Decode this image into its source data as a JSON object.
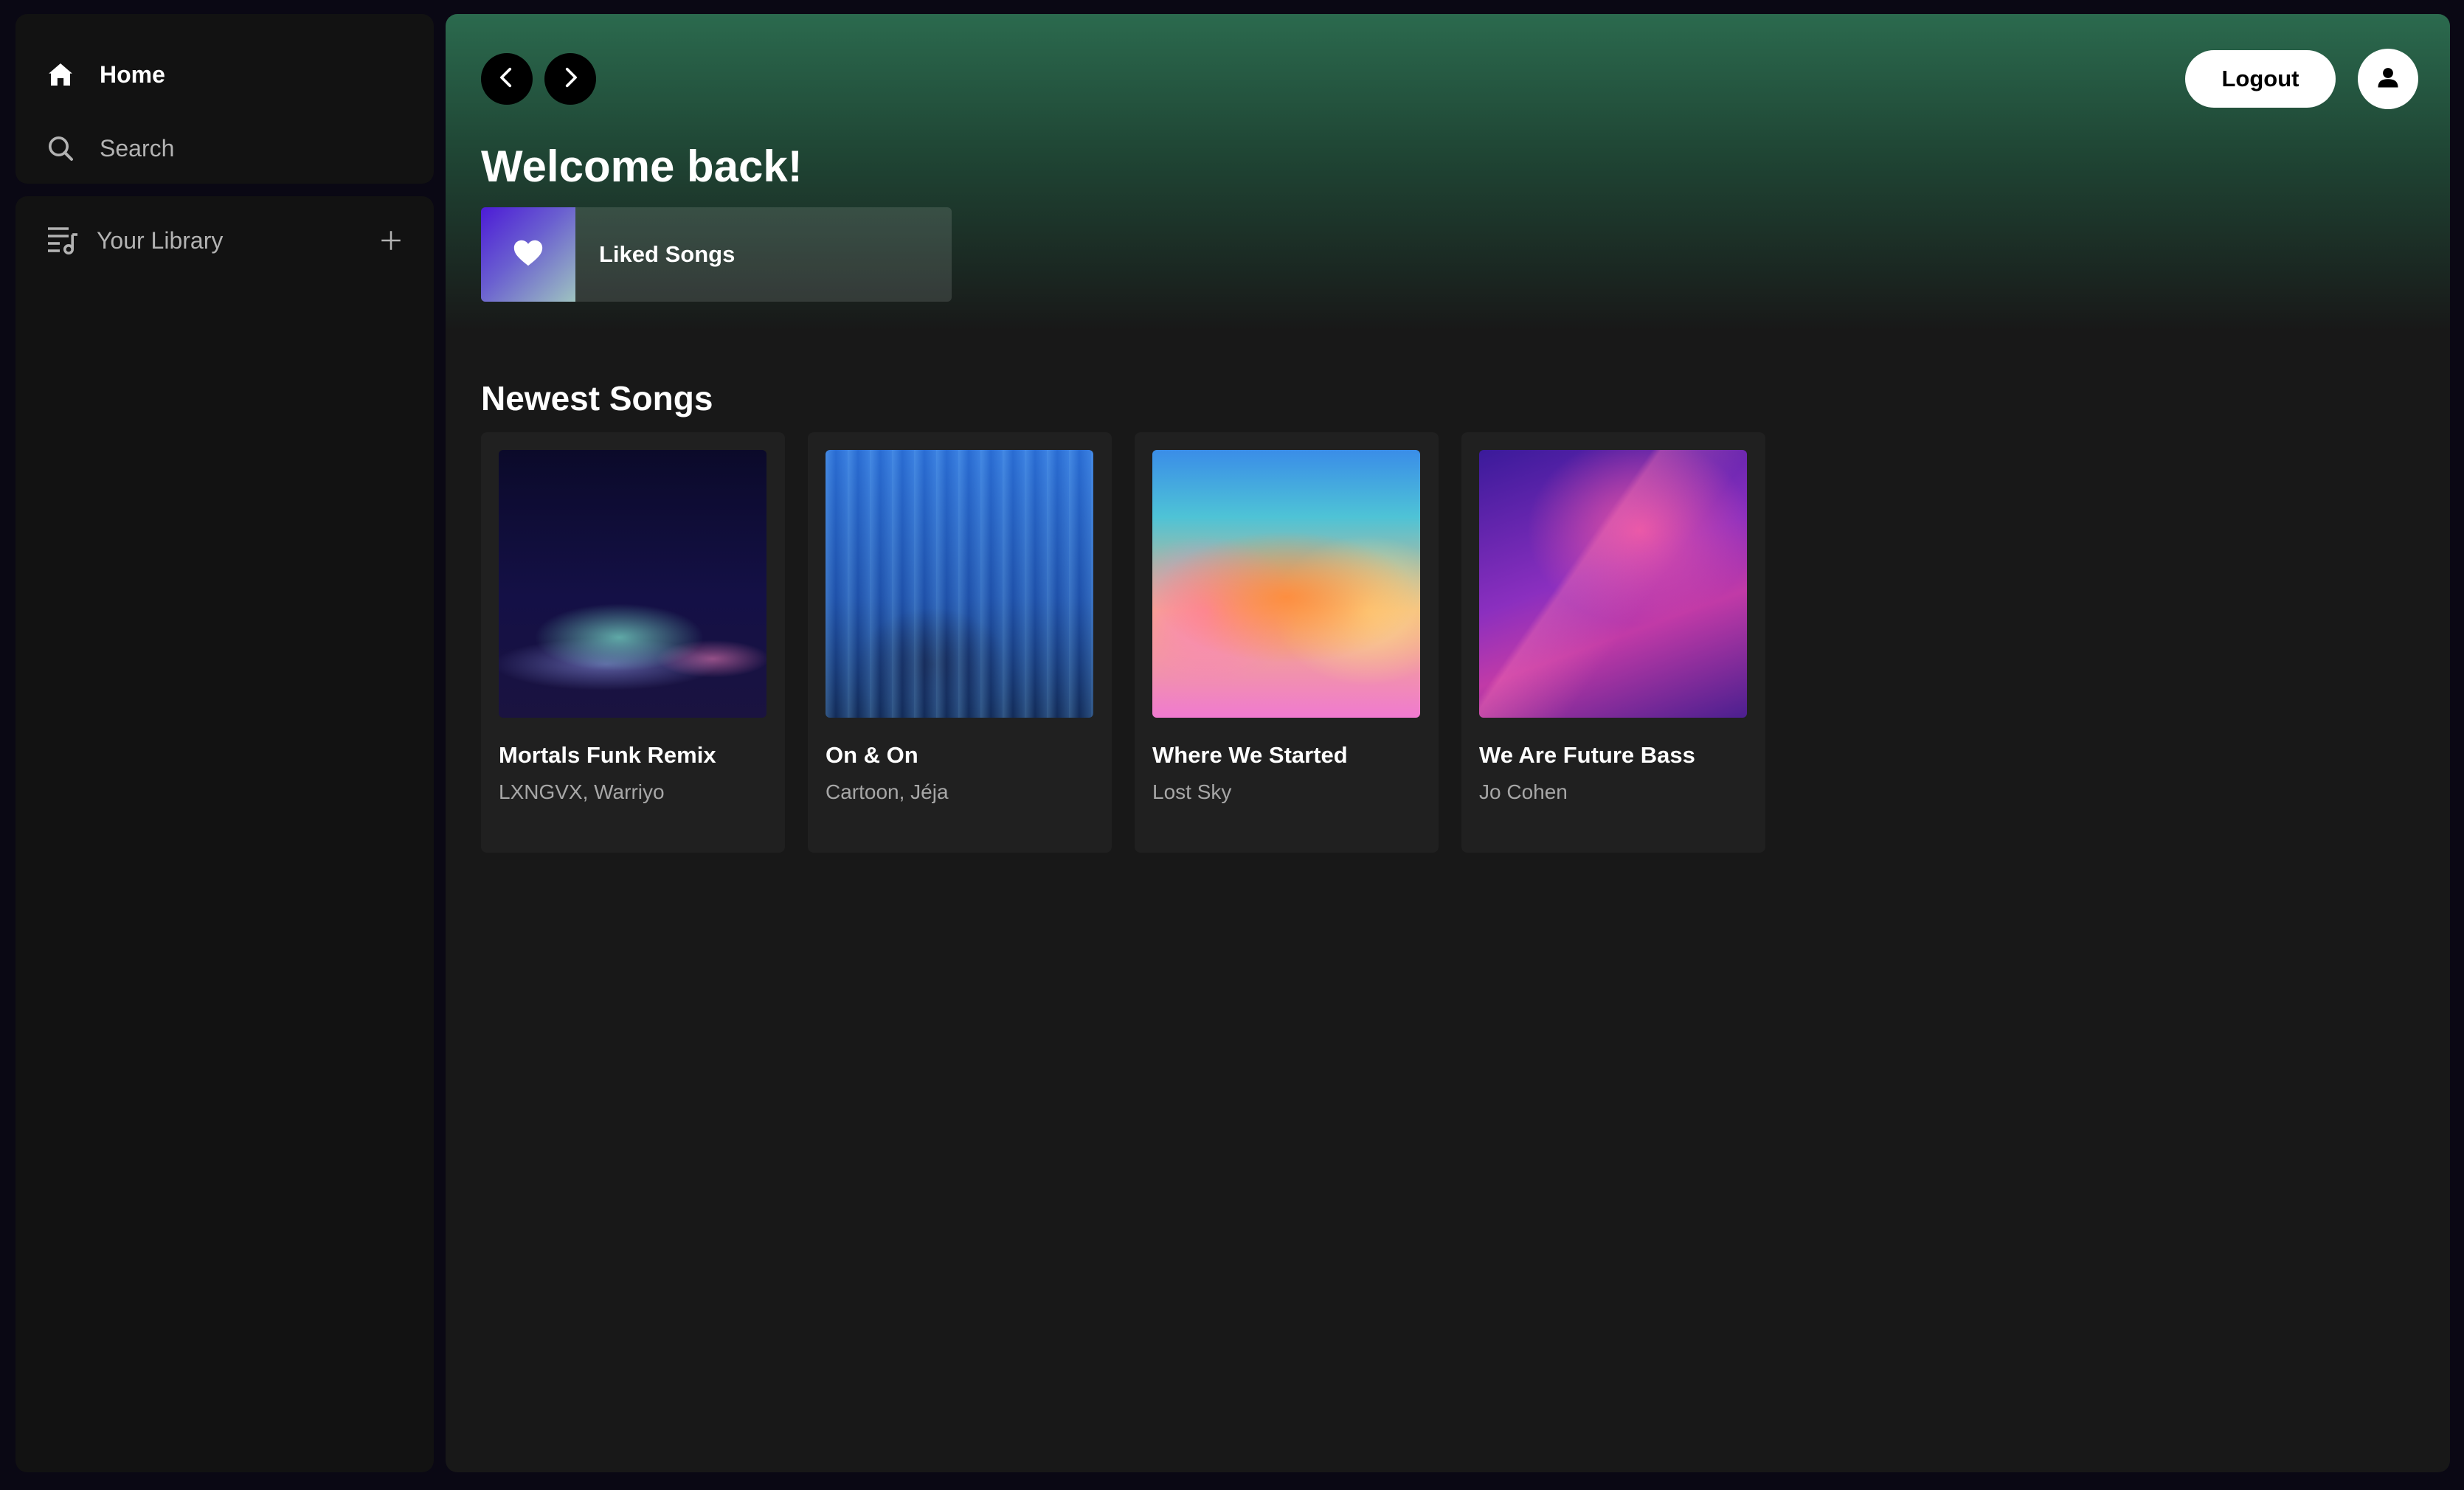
{
  "sidebar": {
    "nav": [
      {
        "label": "Home",
        "icon": "home-icon",
        "active": true
      },
      {
        "label": "Search",
        "icon": "search-icon",
        "active": false
      }
    ],
    "library": {
      "label": "Your Library",
      "icon": "library-icon",
      "add_icon": "plus-icon"
    }
  },
  "header": {
    "back_icon": "chevron-left-icon",
    "forward_icon": "chevron-right-icon",
    "logout_label": "Logout",
    "profile_icon": "user-icon"
  },
  "main": {
    "welcome": "Welcome back!",
    "liked": {
      "label": "Liked Songs",
      "icon": "heart-icon"
    },
    "section_title": "Newest Songs",
    "songs": [
      {
        "title": "Mortals Funk Remix",
        "artist": "LXNGVX, Warriyo"
      },
      {
        "title": "On & On",
        "artist": "Cartoon, Jéja"
      },
      {
        "title": "Where We Started",
        "artist": "Lost Sky"
      },
      {
        "title": "We Are Future Bass",
        "artist": "Jo Cohen"
      }
    ]
  },
  "colors": {
    "accent_green": "#2b6a4e",
    "panel": "#121212",
    "card": "#202020",
    "background": "#0a0814"
  }
}
